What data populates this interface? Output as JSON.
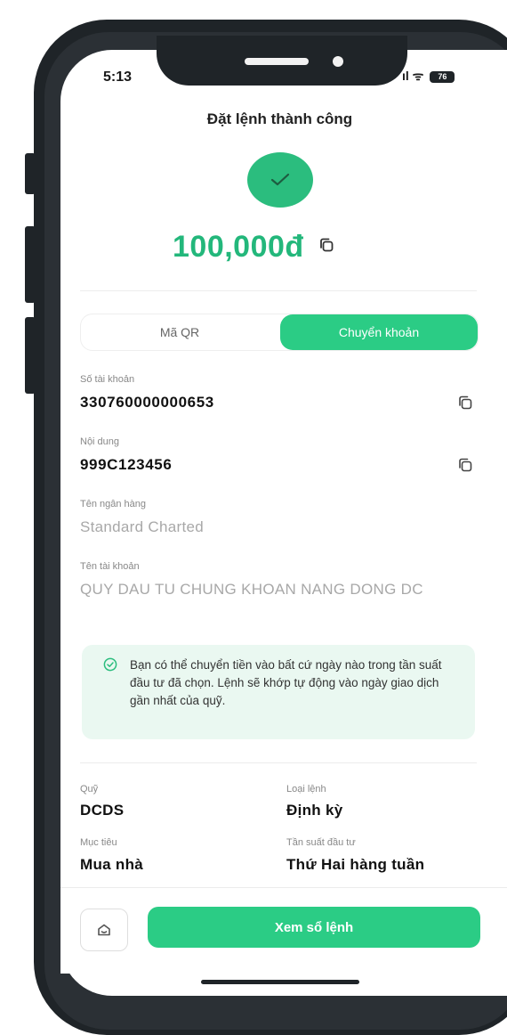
{
  "status_bar": {
    "time": "5:13",
    "signal": "ıl",
    "wifi": "ᯤ",
    "battery": "76"
  },
  "header": {
    "title": "Đặt lệnh thành công"
  },
  "result": {
    "amount": "100,000đ"
  },
  "tabs": [
    {
      "label": "Mã QR",
      "active": false
    },
    {
      "label": "Chuyển khoản",
      "active": true
    }
  ],
  "transfer": {
    "account_number": {
      "label": "Số tài khoản",
      "value": "330760000000653"
    },
    "content": {
      "label": "Nội dung",
      "value": "999C123456"
    },
    "bank_name": {
      "label": "Tên ngân hàng",
      "value": "Standard Charted"
    },
    "account_name": {
      "label": "Tên tài khoản",
      "value": "QUY DAU TU CHUNG KHOAN NANG DONG DC"
    }
  },
  "notice": {
    "text": "Bạn có thể chuyển tiền vào bất cứ ngày nào trong tần suất đầu tư đã chọn. Lệnh sẽ khớp tự động vào ngày giao dịch gần nhất của quỹ."
  },
  "order_info": {
    "fund": {
      "label": "Quỹ",
      "value": "DCDS"
    },
    "order_type": {
      "label": "Loại lệnh",
      "value": "Định kỳ"
    },
    "goal": {
      "label": "Mục tiêu",
      "value": "Mua nhà"
    },
    "frequency": {
      "label": "Tần suất đầu tư",
      "value": "Thứ Hai hàng tuần"
    }
  },
  "footer": {
    "primary_button": "Xem sổ lệnh"
  },
  "colors": {
    "accent": "#2bcc85",
    "amount": "#23b77b",
    "notice_bg": "#eaf8f1"
  }
}
